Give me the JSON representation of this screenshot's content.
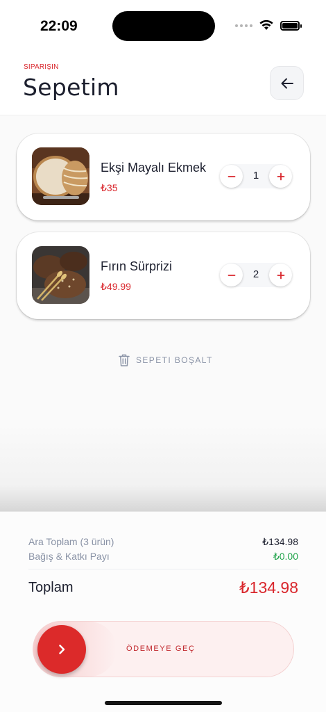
{
  "status_bar": {
    "time": "22:09",
    "icons": [
      "signal-dots-icon",
      "wifi-icon",
      "battery-icon"
    ]
  },
  "header": {
    "eyebrow": "SIPARIŞIN",
    "title": "Sepetim",
    "back_icon": "arrow-left-icon"
  },
  "cart": {
    "items": [
      {
        "name": "Ekşi Mayalı Ekmek",
        "price": "₺35",
        "quantity": "1",
        "image": "sourdough-bread-image"
      },
      {
        "name": "Fırın Sürprizi",
        "price": "₺49.99",
        "quantity": "2",
        "image": "rye-bread-wheat-image"
      }
    ],
    "clear_label": "SEPETI BOŞALT"
  },
  "summary": {
    "subtotal_label": "Ara Toplam (3 ürün)",
    "subtotal_value": "₺134.98",
    "donation_label": "Bağış & Katkı Payı",
    "donation_value": "₺0.00",
    "total_label": "Toplam",
    "total_value": "₺134.98"
  },
  "checkout": {
    "label": "ÖDEMEYE GEÇ"
  },
  "colors": {
    "accent": "#d9262c",
    "success": "#1fa34a",
    "muted": "#8a93a6",
    "text": "#1c1f2e"
  }
}
